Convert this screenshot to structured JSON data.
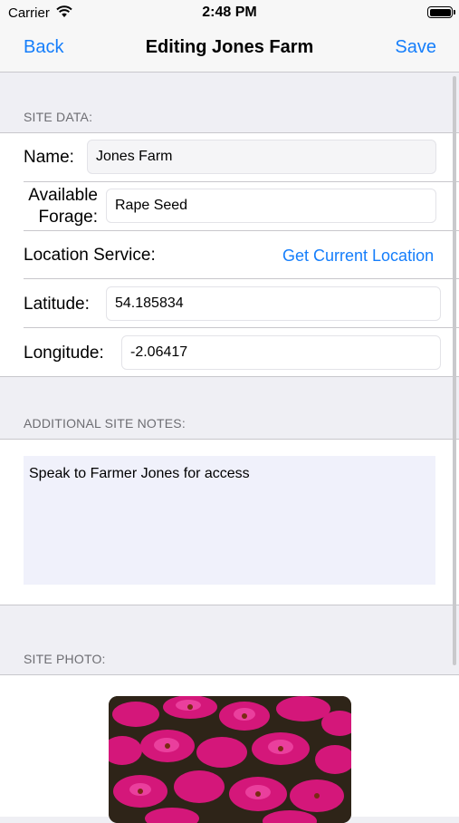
{
  "status_bar": {
    "carrier": "Carrier",
    "time": "2:48 PM"
  },
  "nav": {
    "back_label": "Back",
    "title": "Editing Jones Farm",
    "save_label": "Save"
  },
  "site_data": {
    "header": "SITE DATA:",
    "name_label": "Name:",
    "name_value": "Jones Farm",
    "forage_label_1": "Available",
    "forage_label_2": "Forage:",
    "forage_value": "Rape Seed",
    "location_label": "Location Service:",
    "location_link": "Get Current Location",
    "latitude_label": "Latitude:",
    "latitude_value": "54.185834",
    "longitude_label": "Longitude:",
    "longitude_value": "-2.06417"
  },
  "notes": {
    "header": "ADDITIONAL SITE NOTES:",
    "text": "Speak to Farmer Jones for access"
  },
  "photo": {
    "header": "SITE PHOTO:",
    "description": "Photo of magenta flowers"
  },
  "colors": {
    "accent": "#157efb",
    "background": "#efeff4"
  }
}
